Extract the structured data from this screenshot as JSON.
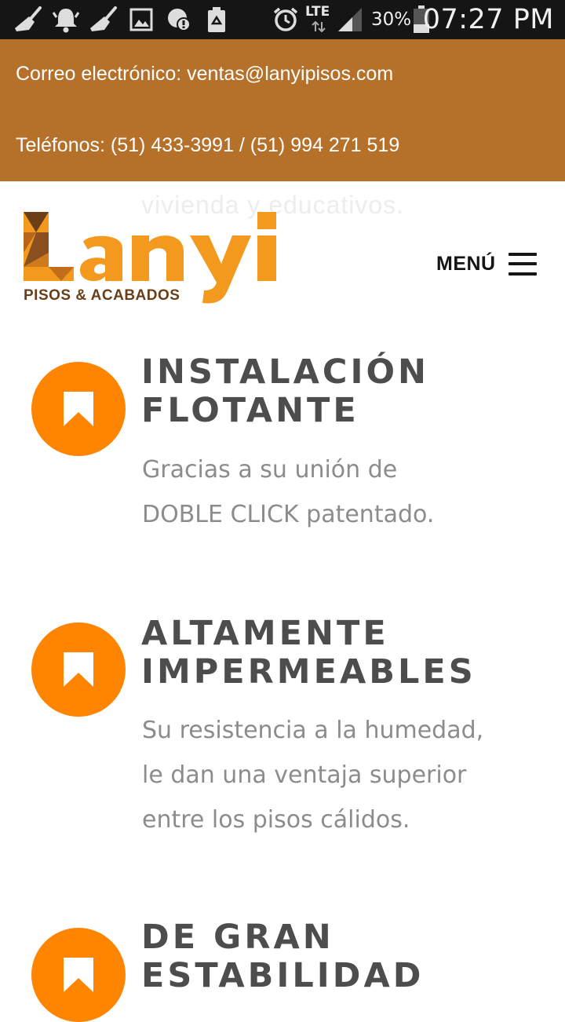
{
  "status_bar": {
    "time": "07:27 PM",
    "battery_percent": "30%",
    "network": "LTE",
    "icons": [
      "broom-icon",
      "bell-icon",
      "broom-icon",
      "image-icon",
      "alert-icon",
      "recycle-icon",
      "alarm-icon",
      "signal-icon",
      "battery-icon"
    ]
  },
  "contact": {
    "email_line": "Correo electrónico: ventas@lanyipisos.com",
    "phone_line": "Teléfonos: (51) 433-3991 / (51) 994 271 519"
  },
  "background_text": "vivienda y educativos.",
  "header": {
    "logo_title": "Lanyi",
    "logo_subtitle": "PISOS & ACABADOS",
    "menu_label": "MENÚ"
  },
  "features": [
    {
      "title_line1": "INSTALACIÓN",
      "title_line2": "FLOTANTE",
      "desc_line1": "Gracias a su unión de",
      "desc_line2": "DOBLE CLICK patentado.",
      "desc_line3": ""
    },
    {
      "title_line1": "ALTAMENTE",
      "title_line2": "IMPERMEABLES",
      "desc_line1": "Su resistencia a la humedad,",
      "desc_line2": "le dan una ventaja superior",
      "desc_line3": "entre los pisos cálidos."
    },
    {
      "title_line1": "DE GRAN",
      "title_line2": "ESTABILIDAD",
      "desc_line1": "",
      "desc_line2": "",
      "desc_line3": ""
    }
  ],
  "colors": {
    "contact_bar": "#b5702a",
    "accent_orange": "#ff8400",
    "logo_orange": "#f39a1e",
    "logo_brown": "#8a5020",
    "title_gray": "#4d4d4d",
    "text_gray": "#8c8c8c"
  }
}
